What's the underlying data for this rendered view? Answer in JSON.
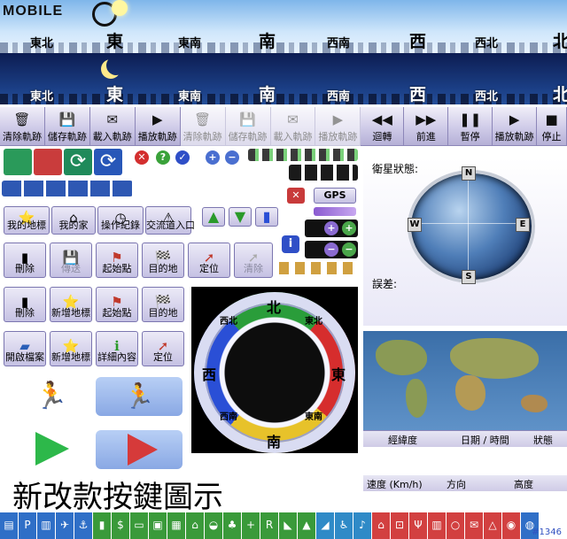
{
  "brand": {
    "text": "MOBILE"
  },
  "banner_day": {
    "labels": [
      "東北",
      "東",
      "東南",
      "南",
      "西南",
      "西",
      "西北",
      "北"
    ]
  },
  "banner_night": {
    "labels": [
      "東北",
      "東",
      "東南",
      "南",
      "西南",
      "西",
      "西北",
      "北"
    ]
  },
  "toolbar": {
    "items": [
      {
        "label": "清除軌跡",
        "icon": "trash-icon"
      },
      {
        "label": "儲存軌跡",
        "icon": "save-icon"
      },
      {
        "label": "載入軌跡",
        "icon": "load-icon"
      },
      {
        "label": "播放軌跡",
        "icon": "play-icon"
      },
      {
        "label": "清除軌跡",
        "icon": "trash-icon"
      },
      {
        "label": "儲存軌跡",
        "icon": "save-icon"
      },
      {
        "label": "載入軌跡",
        "icon": "load-icon"
      },
      {
        "label": "播放軌跡",
        "icon": "play-icon"
      },
      {
        "label": "迴轉",
        "icon": "rewind-icon"
      },
      {
        "label": "前進",
        "icon": "forward-icon"
      },
      {
        "label": "暫停",
        "icon": "pause-icon"
      },
      {
        "label": "播放軌跡",
        "icon": "play-icon"
      },
      {
        "label": "停止",
        "icon": "stop-icon"
      }
    ]
  },
  "gps": {
    "label": "GPS"
  },
  "nav_buttons": [
    {
      "label": "我的地標"
    },
    {
      "label": "我的家"
    },
    {
      "label": "操作紀錄"
    },
    {
      "label": "交流道入口"
    }
  ],
  "action_row_1": [
    {
      "label": "刪除"
    },
    {
      "label": "傳送"
    },
    {
      "label": "起始點"
    },
    {
      "label": "目的地"
    },
    {
      "label": "定位"
    },
    {
      "label": "清除"
    }
  ],
  "action_row_2": [
    {
      "label": "刪除"
    },
    {
      "label": "新增地標"
    },
    {
      "label": "起始點"
    },
    {
      "label": "目的地"
    }
  ],
  "action_row_3": [
    {
      "label": "開啟檔案"
    },
    {
      "label": "新增地標"
    },
    {
      "label": "詳細內容"
    },
    {
      "label": "定位"
    }
  ],
  "satellite": {
    "title": "衛星狀態:",
    "error_label": "誤差:",
    "cardinals": [
      "N",
      "E",
      "S",
      "W"
    ]
  },
  "info_table": {
    "headers_1": [
      "經緯度",
      "日期 / 時間",
      "狀態"
    ],
    "headers_2": [
      "速度 (Km/h)",
      "方向",
      "高度"
    ]
  },
  "compass": {
    "north": "北",
    "east": "東",
    "south": "南",
    "west": "西",
    "ne": "東北",
    "nw": "西北",
    "se": "東南",
    "sw": "西南"
  },
  "caption": "新改款按鍵圖示",
  "watermark": "#1346",
  "colors": {
    "toolbar_bg": "#cfcbe8",
    "bottom_bar": "#3a9a3a",
    "bottom_bar_red": "#d24040"
  }
}
